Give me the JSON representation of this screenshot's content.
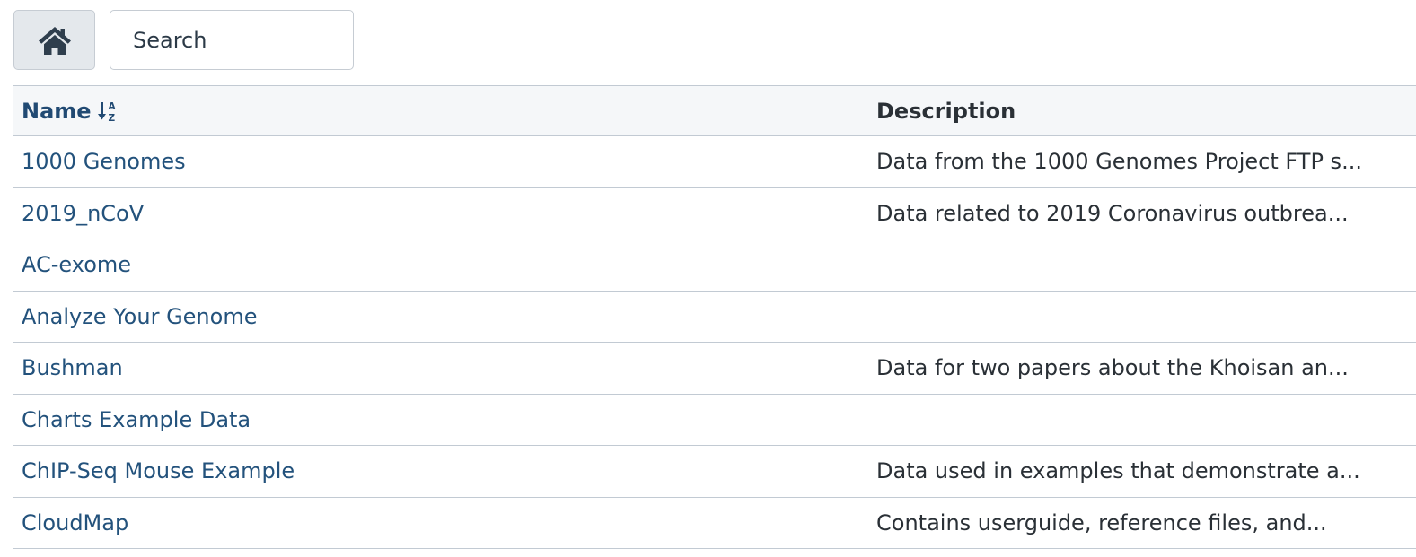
{
  "toolbar": {
    "home_icon": "home-icon",
    "search_placeholder": "Search"
  },
  "table": {
    "columns": {
      "name": "Name",
      "description": "Description",
      "sort_icon": "sort-alpha-down-icon"
    },
    "rows": [
      {
        "name": "1000 Genomes",
        "description": "Data from the 1000 Genomes Project FTP s..."
      },
      {
        "name": "2019_nCoV",
        "description": "Data related to 2019 Coronavirus outbrea..."
      },
      {
        "name": "AC-exome",
        "description": ""
      },
      {
        "name": "Analyze Your Genome",
        "description": ""
      },
      {
        "name": "Bushman",
        "description": "Data for two papers about the Khoisan an..."
      },
      {
        "name": "Charts Example Data",
        "description": ""
      },
      {
        "name": "ChIP-Seq Mouse Example",
        "description": "Data used in examples that demonstrate a..."
      },
      {
        "name": "CloudMap",
        "description": "Contains userguide, reference files, and..."
      }
    ]
  },
  "colors": {
    "link": "#23527c",
    "header_link": "#214a73",
    "text": "#2a3036",
    "border": "#c2cad3",
    "header_bg": "#f5f7f9",
    "button_bg": "#e4e8ec"
  }
}
